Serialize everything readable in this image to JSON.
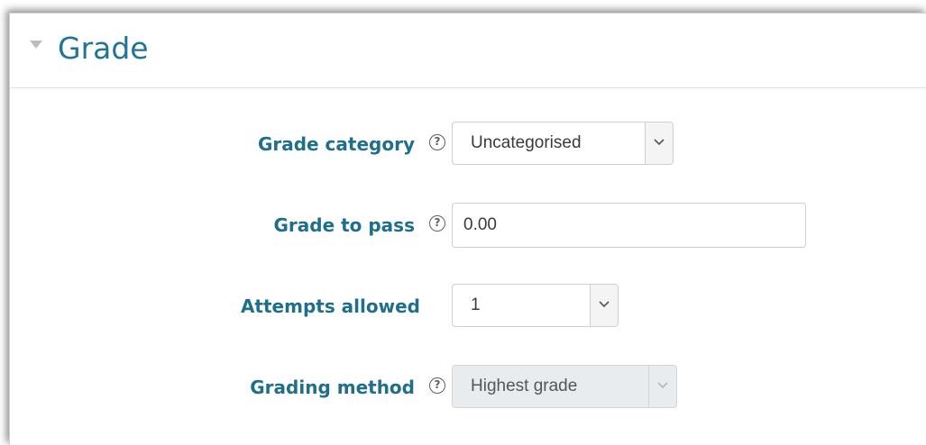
{
  "section": {
    "title": "Grade",
    "collapse_icon": "triangle-down-icon"
  },
  "fields": {
    "grade_category": {
      "label": "Grade category",
      "help_icon": "question-circle-icon",
      "help_glyph": "?",
      "value": "Uncategorised"
    },
    "grade_to_pass": {
      "label": "Grade to pass",
      "help_icon": "question-circle-icon",
      "help_glyph": "?",
      "value": "0.00"
    },
    "attempts_allowed": {
      "label": "Attempts allowed",
      "value": "1"
    },
    "grading_method": {
      "label": "Grading method",
      "help_icon": "question-circle-icon",
      "help_glyph": "?",
      "value": "Highest grade",
      "disabled": true
    }
  },
  "colors": {
    "title": "#1f7594",
    "label": "#1f6f8c",
    "border": "#cfcfcf",
    "disabled_bg": "#e9ecef"
  }
}
